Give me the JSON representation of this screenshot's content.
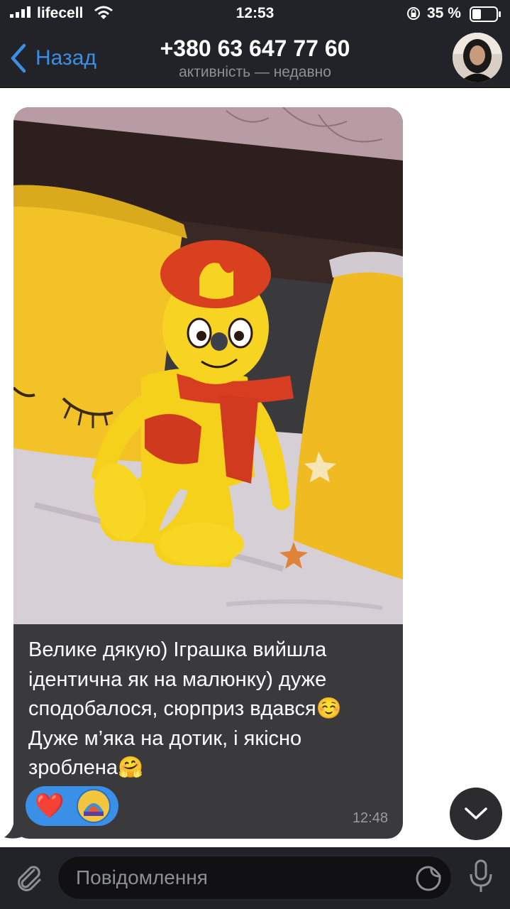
{
  "status_bar": {
    "carrier": "lifecell",
    "time": "12:53",
    "battery_text": "35 %",
    "icons": [
      "signal-icon",
      "wifi-icon",
      "rotation-lock-icon",
      "battery-icon"
    ]
  },
  "header": {
    "back_label": "Назад",
    "title": "+380 63 647 77 60",
    "status": "активність — недавно",
    "accent": "#3a8fe6"
  },
  "message": {
    "text": "Велике дякую) Іграшка вийшла\nідентична як на малюнку) дуже\nсподобалося, сюрприз вдався☺️\nДуже м’яка на дотик, і якісно\nзроблена🤗",
    "time": "12:48",
    "reactions": [
      "❤️"
    ],
    "bubble_color": "#3a3a3c"
  },
  "input": {
    "placeholder": "Повідомлення"
  }
}
